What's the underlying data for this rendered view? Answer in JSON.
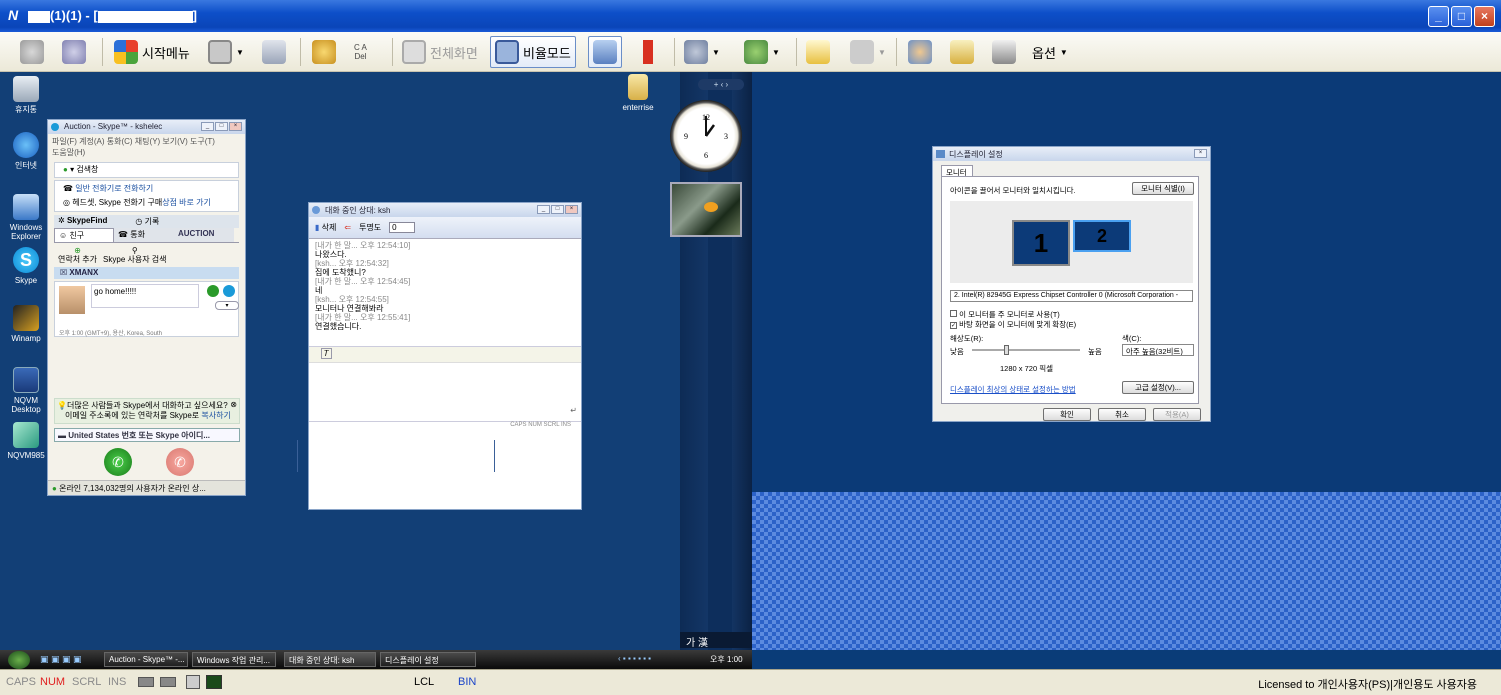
{
  "window": {
    "title_prefix": "(1)(1) - [",
    "title_suffix": "]",
    "logo": "N",
    "minimize": "_",
    "maximize": "□",
    "close": "×"
  },
  "toolbar": {
    "start_menu": "시작메뉴",
    "ctrl_alt_del": "C A\nDel",
    "fullscreen": "전체화면",
    "ratio_mode": "비율모드",
    "options": "옵션"
  },
  "desktop_icons": [
    {
      "label": "휴지통",
      "icon": "recycle-bin-icon"
    },
    {
      "label": "인터넷",
      "icon": "internet-explorer-icon"
    },
    {
      "label": "Windows Explorer",
      "icon": "windows-explorer-icon"
    },
    {
      "label": "Skype",
      "icon": "skype-icon"
    },
    {
      "label": "Winamp",
      "icon": "winamp-icon"
    },
    {
      "label": "NQVM Desktop",
      "icon": "nqvm-desktop-icon"
    },
    {
      "label": "NQVM985",
      "icon": "nqvm985-icon"
    }
  ],
  "folder_icon": {
    "label": "enterrise"
  },
  "skype": {
    "title": "Auction - Skype™ - kshelec",
    "menu1": "파일(F)  계정(A)  통화(C)  채팅(Y)  보기(V)  도구(T)",
    "menu2": "도움말(H)",
    "status": "▾ 검색창",
    "call_link1": "일반 전화기로 전화하기",
    "call_link2": "헤드셋, Skype 전화기 구매",
    "call_link3": "상점 바로 가기",
    "skypefind": "SkypeFind",
    "history": "기록",
    "tab_friends": "친구",
    "tab_calls": "통화",
    "auction": "AUCTION",
    "add_contact": "연락처 추가",
    "search_users": "Skype 사용자 검색",
    "group": "XMANX",
    "mood": "go home!!!!!",
    "location": "오후 1:00 (GMT+9), 용산, Korea, South",
    "promo1": "더많은 사람들과 Skype에서 대화하고 싶으세요?",
    "promo2": "이메일 주소록에 있는 연락처를 Skype로",
    "promo_link": "복사하기",
    "phone_placeholder": "United States 번호 또는 Skype 아이디...",
    "online": "온라인 7,134,032명의 사용자가 온라인 상..."
  },
  "chat": {
    "title": "대화 중인 상대: ksh",
    "delete": "삭제",
    "transparency": "투명도",
    "transparency_value": "0",
    "lines": [
      {
        "meta": "[내가 한 말... 오후 12:54:10]",
        "text": "나왔스다."
      },
      {
        "meta": "[ksh... 오후 12:54:32]",
        "text": "집에 도착했니?"
      },
      {
        "meta": "[내가 한 말... 오후 12:54:45]",
        "text": "네"
      },
      {
        "meta": "[ksh... 오후 12:54:55]",
        "text": "모니터나 연결해봐라"
      },
      {
        "meta": "[내가 한 말... 오후 12:55:41]",
        "text": "연결했습니다."
      }
    ],
    "status": "CAPS  NUM  SCRL  INS"
  },
  "display": {
    "title": "디스플레이 설정",
    "tab": "모니터",
    "instruction": "아이콘을 끌어서 모니터와 일치시킵니다.",
    "identify": "모니터 식별(I)",
    "monitor1": "1",
    "monitor2": "2",
    "adapter": "2. Intel(R) 82945G Express Chipset Controller 0 (Microsoft Corporation -",
    "primary": "이 모니터를 주 모니터로 사용(T)",
    "extend": "바탕 화면을 이 모니터에 맞게 확장(E)",
    "resolution_label": "해상도(R):",
    "low": "낮음",
    "high": "높음",
    "resolution": "1280 x 720 픽셀",
    "color_label": "색(C):",
    "color_value": "아주 높음(32비트)",
    "help_link": "디스플레이 최상의 상태로 설정하는 방법",
    "advanced": "고급 설정(V)...",
    "ok": "확인",
    "cancel": "취소",
    "apply": "적용(A)",
    "resolution_fraction": 0.3
  },
  "sidebar": {
    "ime": "가 漢"
  },
  "taskbar": {
    "tasks": [
      "Auction - Skype™ -...",
      "Windows 작업 관리...",
      "대화 중인 상대: ksh",
      "디스플레이 설정"
    ],
    "clock": "오후 1:00"
  },
  "statusbar": {
    "caps": "CAPS",
    "num": "NUM",
    "scrl": "SCRL",
    "ins": "INS",
    "lcl": "LCL",
    "bin": "BIN",
    "license": "Licensed to 개인사용자(PS)|개인용도 사용자용"
  },
  "colors": {
    "num_red": "#e02020",
    "bin_blue": "#1a44c8"
  }
}
